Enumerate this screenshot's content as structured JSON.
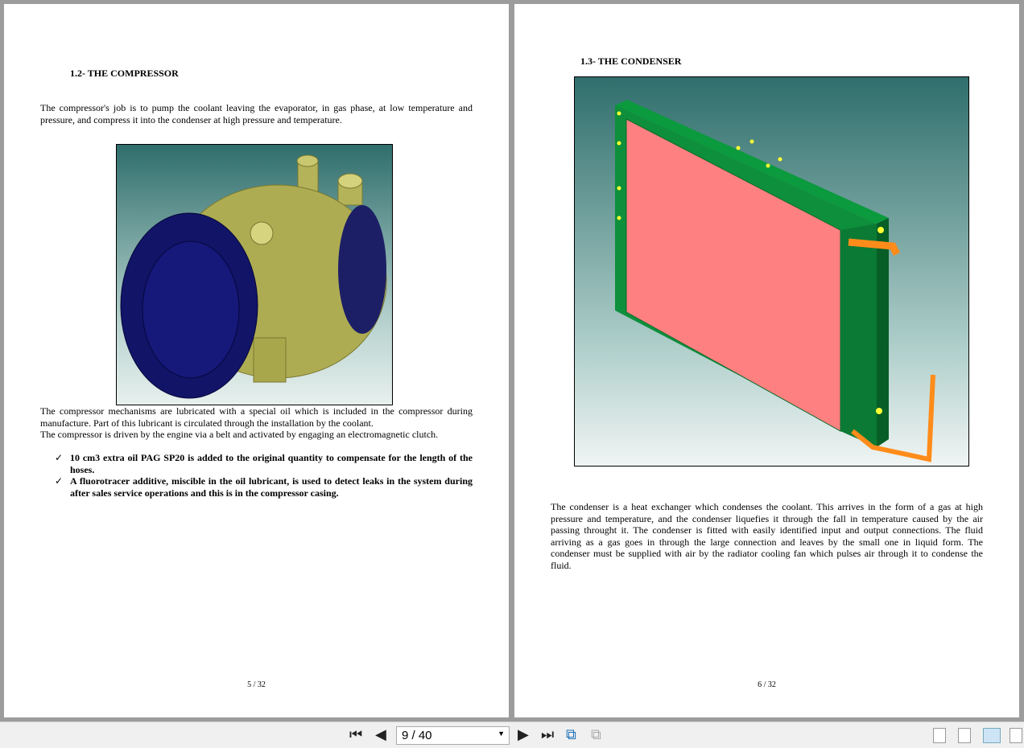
{
  "left_page": {
    "heading": "1.2- THE COMPRESSOR",
    "intro": "The compressor's job is to pump the coolant leaving the evaporator, in gas phase, at low temperature and pressure, and compress it into the condenser at high pressure and temperature.",
    "para1": "The compressor mechanisms are lubricated with a special oil which is included in the compressor during manufacture. Part of this lubricant is circulated through the installation by the coolant.",
    "para2": "The compressor is driven by the engine via a belt and activated by engaging an electromagnetic clutch.",
    "bullets": [
      "10 cm3 extra oil PAG SP20 is added to the original quantity to compensate for the length of the hoses.",
      "A fluorotracer additive, miscible in the oil lubricant, is used to detect leaks in the system during after sales service operations and this is in the compressor casing."
    ],
    "check": "✓",
    "page_number": "5 / 32"
  },
  "right_page": {
    "heading": "1.3- THE CONDENSER",
    "para": "The condenser is a heat exchanger which condenses the coolant. This arrives in the form of a gas at high pressure and temperature, and the condenser liquefies it through the fall in temperature caused by the air passing throught it. The condenser is fitted with easily identified input and output connections. The fluid arriving as a gas goes in through the large connection and leaves by the small one in liquid form. The condenser must be supplied with air by the radiator cooling fan which pulses air through it to condense the fluid.",
    "page_number": "6 / 32"
  },
  "toolbar": {
    "page_field": "9 / 40"
  }
}
